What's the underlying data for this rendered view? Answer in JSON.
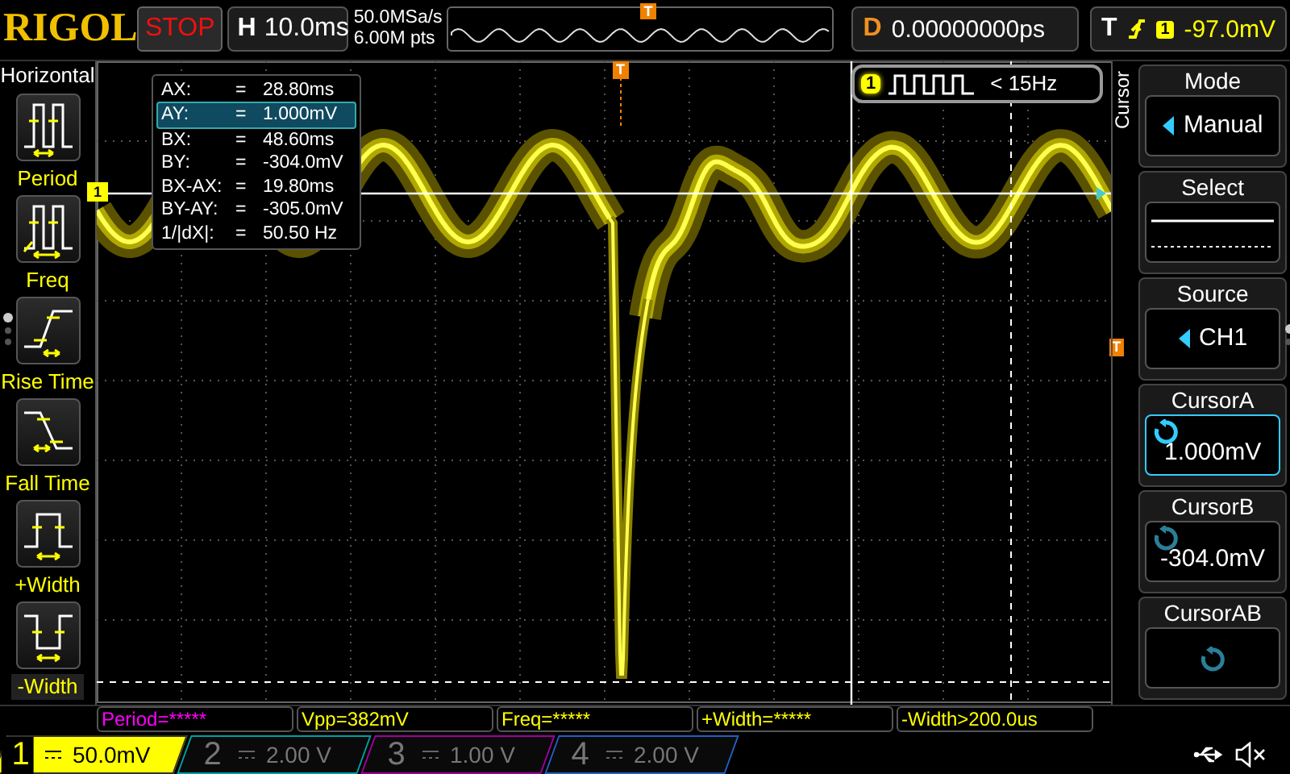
{
  "brand": "RIGOL",
  "run_state": "STOP",
  "horizontal": {
    "label": "H",
    "timebase": "10.0ms",
    "sample_rate": "50.0MSa/s",
    "memory_depth": "6.00M pts",
    "trigger_marker": "T"
  },
  "delay": {
    "label": "D",
    "value": "0.00000000ps"
  },
  "trigger": {
    "label": "T",
    "source": "1",
    "level": "-97.0mV"
  },
  "left_menu": {
    "title": "Horizontal",
    "items": [
      {
        "label": "Period",
        "kind": "period"
      },
      {
        "label": "Freq",
        "kind": "freq"
      },
      {
        "label": "Rise Time",
        "kind": "rise"
      },
      {
        "label": "Fall Time",
        "kind": "fall"
      },
      {
        "label": "+Width",
        "kind": "pwidth"
      },
      {
        "label": "-Width",
        "kind": "nwidth"
      }
    ],
    "page_dots": [
      {
        "selected": true
      },
      {
        "selected": false
      },
      {
        "selected": false
      }
    ]
  },
  "scope": {
    "channel_marker": "1",
    "trigger_level_marker": "T",
    "trigger_position_marker": "T",
    "frequency_badge": {
      "channel": "1",
      "text": "< 15Hz"
    },
    "cursor_readout": [
      {
        "name": "AX:",
        "eq": "=",
        "value": "28.80ms",
        "selected": false
      },
      {
        "name": "AY:",
        "eq": "=",
        "value": "1.000mV",
        "selected": true
      },
      {
        "name": "BX:",
        "eq": "=",
        "value": "48.60ms",
        "selected": false
      },
      {
        "name": "BY:",
        "eq": "=",
        "value": "-304.0mV",
        "selected": false
      },
      {
        "name": "BX-AX:",
        "eq": "=",
        "value": "19.80ms",
        "selected": false
      },
      {
        "name": "BY-AY:",
        "eq": "=",
        "value": "-305.0mV",
        "selected": false
      },
      {
        "name": "1/|dX|:",
        "eq": "=",
        "value": "50.50 Hz",
        "selected": false
      }
    ]
  },
  "right_menu": {
    "title": "Cursor",
    "items": [
      {
        "label": "Mode",
        "kind": "select",
        "value": "Manual",
        "selected": false
      },
      {
        "label": "Select",
        "kind": "lines",
        "selected": false
      },
      {
        "label": "Source",
        "kind": "select",
        "value": "CH1",
        "selected": false
      },
      {
        "label": "CursorA",
        "kind": "knob",
        "value": "1.000mV",
        "selected": true
      },
      {
        "label": "CursorB",
        "kind": "knob",
        "value": "-304.0mV",
        "selected": false
      },
      {
        "label": "CursorAB",
        "kind": "knob",
        "selected": false
      }
    ],
    "page_dots": [
      {
        "selected": true
      },
      {
        "selected": false
      }
    ]
  },
  "measurements": [
    {
      "text": "Period=*****",
      "color": "#ff00ff"
    },
    {
      "text": "Vpp=382mV",
      "color": "#ffff00"
    },
    {
      "text": "Freq=*****",
      "color": "#ffff00"
    },
    {
      "text": "+Width=*****",
      "color": "#ffff00"
    },
    {
      "text": "-Width>200.0us",
      "color": "#ffff00"
    }
  ],
  "channels": [
    {
      "number": "1",
      "scale": "50.0mV",
      "on": true,
      "color": "#ffff00"
    },
    {
      "number": "2",
      "scale": "2.00 V",
      "on": false,
      "color": "#00a0a0"
    },
    {
      "number": "3",
      "scale": "1.00 V",
      "on": false,
      "color": "#a000a0"
    },
    {
      "number": "4",
      "scale": "2.00 V",
      "on": false,
      "color": "#2060c0"
    }
  ]
}
